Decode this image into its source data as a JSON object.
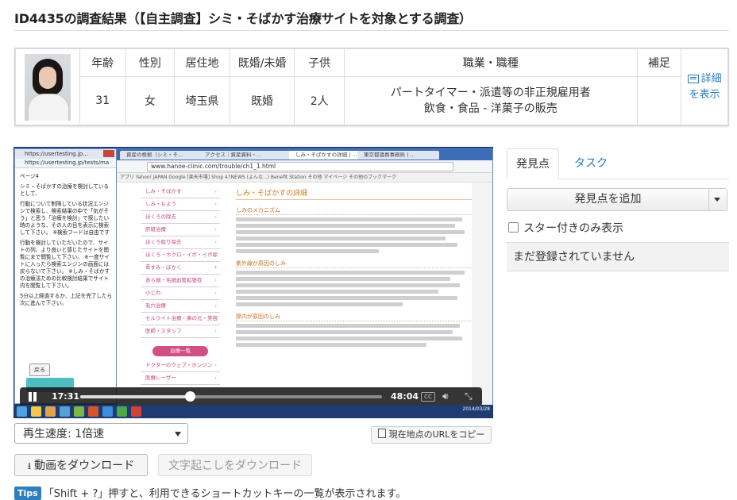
{
  "page": {
    "title": "ID4435の調査結果（【自主調査】シミ・そばかす治療サイトを対象とする調査）"
  },
  "profile": {
    "headers": [
      "年齢",
      "性別",
      "居住地",
      "既婚/未婚",
      "子供",
      "職業・職種",
      "補足"
    ],
    "age": "31",
    "gender": "女",
    "residence": "埼玉県",
    "marital": "既婚",
    "children": "2人",
    "job_line1": "パートタイマー・派遣等の非正規雇用者",
    "job_line2": "飲食・食品 - 洋菓子の販売",
    "note": "",
    "detail_link_line1": "詳細",
    "detail_link_line2": "を表示"
  },
  "video": {
    "current_time": "17:31",
    "duration": "48:04",
    "progress_fraction": 0.364,
    "cc_label": "CC",
    "left_window": {
      "tab_title": "https://usertesting.jp...",
      "url": "https://usertesting.jp/tests/ma",
      "texts": [
        "ページ4",
        "シミ・そばかすの治療を検討しているとして、",
        "行動について制限している状況エンジンで検索し、検索結果の中で「気がそう」と思う「治療を検討」で探したい時のような、その人の目を表示に検索して下さい。 ※検索フードは自由です",
        "行動を検討していただいたので、サイトの列、より良いと感じたサイトを閲覧にまで閲覧して下さい。 ※一度サイトに入ったら検索エンジンの画面には戻らないで下さい。 ※しみ・そばかすの治療法ための比較検討結果でサイト内を閲覧して下さい。",
        "5分以上経過するか、上記を完了したら次に進んで下さい。"
      ],
      "back_button": "戻る"
    },
    "main_window": {
      "tabs": [
        "資産の根拠（シミ・そ...",
        "アクセス｜資産資料・...",
        "しみ・そばかすの詳細 | ...",
        "東京都議員事務局 | ..."
      ],
      "url": "www.hanoe-clinic.com/trouble/ch1_1.html",
      "bookmarks": "アプリ  Yahoo! JAPAN  Google  [楽天市場] Shop  47NEWS (よんな...)  Benefit Station  その他  マイページ  その他のブックマーク",
      "sidebar_items": [
        "しみ・そばかす",
        "しみ・もよう",
        "ほくろの除去",
        "肝斑治療",
        "ほくろ取り除去",
        "ほくろ・ホクロ・イボ・イボ除去",
        "くすみ・ぼかく",
        "赤ら顔・毛細血管拡張症",
        "小じわ",
        "毛穴治療",
        "セルライト治療・鼻の元・美容",
        "医師・スタッフ"
      ],
      "sidebar_pill": "治療一覧",
      "sidebar_more": [
        "ドクターのウェブ・ホンジン",
        "医療レーザー"
      ],
      "heading": "しみ・そばかすの詳細",
      "section1": "しみのメカニズム",
      "section2": "紫外線が原因のしみ",
      "section3": "摩内が原因のしみ"
    },
    "taskbar_date": "2014/03/28"
  },
  "below_video": {
    "speed_label": "再生速度: 1倍速",
    "copy_url": "現在地点のURLをコピー",
    "download_video": "動画をダウンロード",
    "download_transcript": "文字起こしをダウンロード",
    "tips_badge": "Tips",
    "tips_text": "「Shift + ?」押すと、利用できるショートカットキーの一覧が表示されます。"
  },
  "panel": {
    "tab_findings": "発見点",
    "tab_tasks": "タスク",
    "add_finding": "発見点を追加",
    "starred_only": "スター付きのみ表示",
    "empty_message": "まだ登録されていません"
  },
  "colors": {
    "link": "#2a7bbf",
    "tips_badge": "#2f7fbf",
    "video_taskbar": "#1f3c71",
    "site_accent": "#d24f85"
  }
}
